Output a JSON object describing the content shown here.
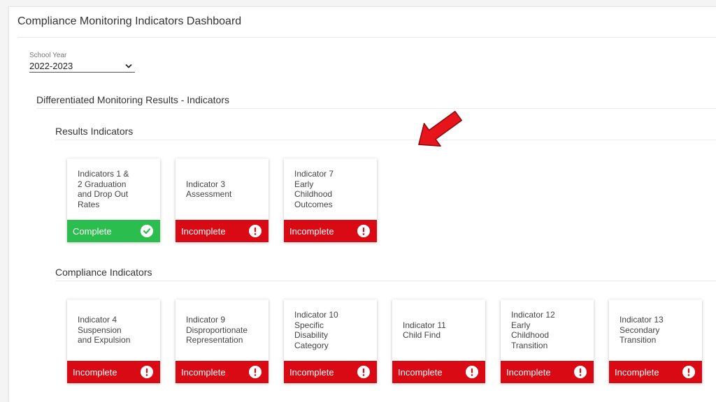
{
  "header": {
    "title": "Compliance Monitoring Indicators Dashboard"
  },
  "filter": {
    "label": "School Year",
    "value": "2022-2023"
  },
  "section": {
    "title": "Differentiated Monitoring Results - Indicators"
  },
  "results_group": {
    "title": "Results Indicators",
    "cards": [
      {
        "text": "Indicators 1 &\n2 Graduation\nand Drop Out\nRates",
        "status": "Complete"
      },
      {
        "text": "Indicator 3\nAssessment",
        "status": "Incomplete"
      },
      {
        "text": "Indicator 7\nEarly\nChildhood\nOutcomes",
        "status": "Incomplete"
      }
    ]
  },
  "compliance_group": {
    "title": "Compliance Indicators",
    "cards": [
      {
        "text": "Indicator 4\nSuspension\nand Expulsion",
        "status": "Incomplete"
      },
      {
        "text": "Indicator 9\nDisproportionate\nRepresentation",
        "status": "Incomplete"
      },
      {
        "text": "Indicator 10\nSpecific\nDisability\nCategory",
        "status": "Incomplete"
      },
      {
        "text": "Indicator 11\nChild Find",
        "status": "Incomplete"
      },
      {
        "text": "Indicator 12\nEarly\nChildhood\nTransition",
        "status": "Incomplete"
      },
      {
        "text": "Indicator 13\nSecondary\nTransition",
        "status": "Incomplete"
      }
    ]
  },
  "colors": {
    "complete": "#2bbd4e",
    "incomplete": "#d90a14",
    "arrow": "#e8141c"
  },
  "icons": {
    "complete": "checkmark-circle-icon",
    "incomplete": "exclamation-circle-icon",
    "select": "chevron-down-icon",
    "annotation": "red-arrow-icon"
  }
}
